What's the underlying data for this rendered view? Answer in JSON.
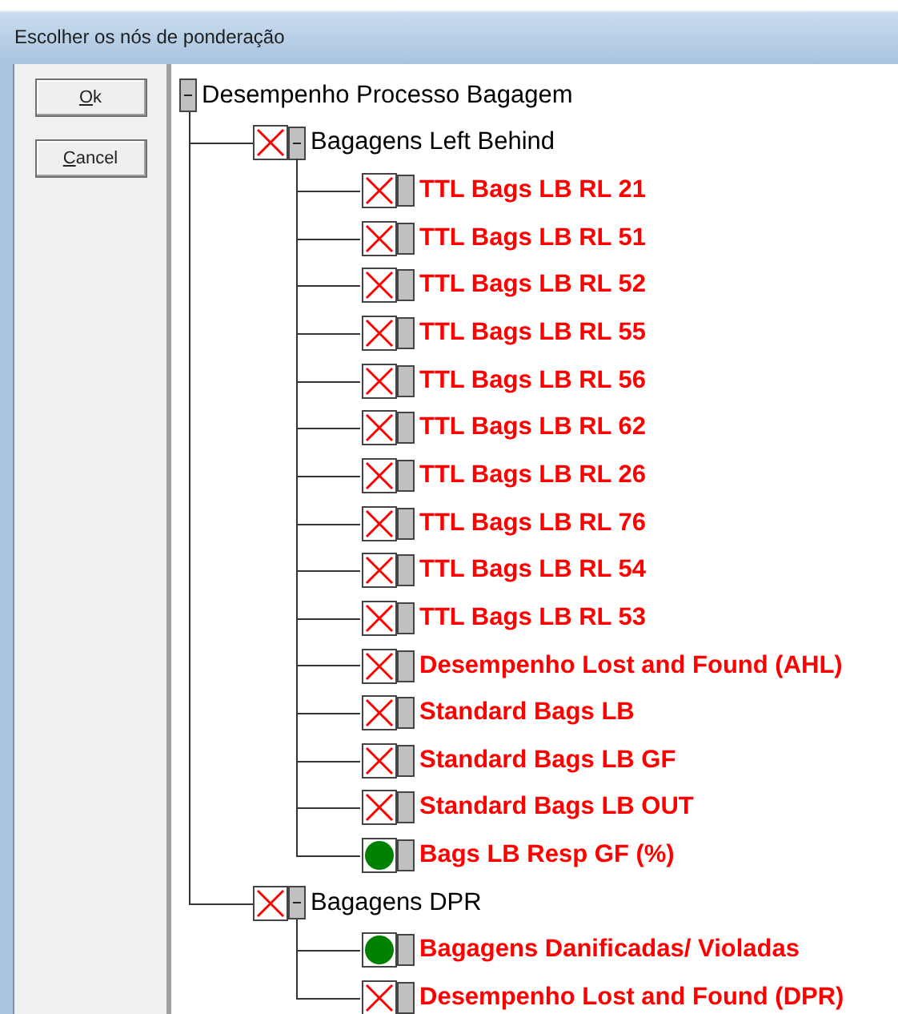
{
  "window": {
    "title": "Escolher os nós de ponderação"
  },
  "buttons": [
    {
      "label": "Ok"
    },
    {
      "label": "Cancel"
    }
  ],
  "tree": {
    "label": "Desempenho Processo Bagagem",
    "expanded": true,
    "children": [
      {
        "label": "Bagagens Left Behind",
        "failed": true,
        "expanded": true,
        "children": [
          {
            "label": "TTL Bags LB RL 21",
            "failed": true
          },
          {
            "label": "TTL Bags LB RL 51",
            "failed": true
          },
          {
            "label": "TTL Bags LB RL 52",
            "failed": true
          },
          {
            "label": "TTL Bags LB RL 55",
            "failed": true
          },
          {
            "label": "TTL Bags LB RL 56",
            "failed": true
          },
          {
            "label": "TTL Bags LB RL 62",
            "failed": true
          },
          {
            "label": "TTL Bags LB RL 26",
            "failed": true
          },
          {
            "label": "TTL Bags LB RL 76",
            "failed": true
          },
          {
            "label": "TTL Bags LB RL 54",
            "failed": true
          },
          {
            "label": "TTL Bags LB RL 53",
            "failed": true
          },
          {
            "label": "Desempenho Lost and Found (AHL)",
            "failed": true
          },
          {
            "label": "Standard Bags LB",
            "failed": true
          },
          {
            "label": "Standard Bags LB GF",
            "failed": true
          },
          {
            "label": "Standard Bags LB OUT",
            "failed": true
          },
          {
            "label": "Bags LB Resp GF (%)",
            "failed": false
          }
        ]
      },
      {
        "label": "Bagagens DPR",
        "failed": true,
        "expanded": true,
        "children": [
          {
            "label": "Bagagens Danificadas/ Violadas",
            "failed": false
          },
          {
            "label": "Desempenho Lost and Found (DPR)",
            "failed": true
          }
        ]
      }
    ]
  }
}
